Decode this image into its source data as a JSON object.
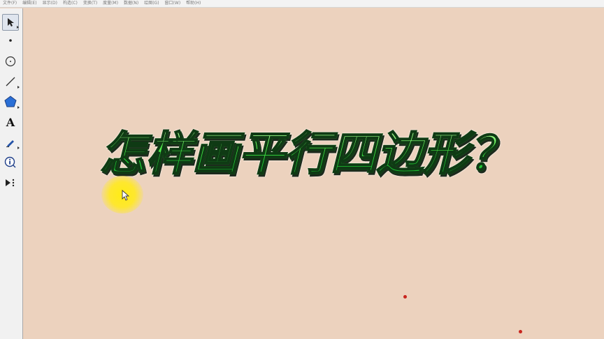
{
  "menu": {
    "items": [
      "文件(F)",
      "编辑(E)",
      "显示(D)",
      "构造(C)",
      "变换(T)",
      "度量(M)",
      "数据(N)",
      "绘图(G)",
      "窗口(W)",
      "帮助(H)"
    ]
  },
  "toolbar": {
    "tools": [
      {
        "name": "selection-arrow-tool",
        "icon": "arrow-pointer-icon",
        "active": true
      },
      {
        "name": "point-tool",
        "icon": "point-icon"
      },
      {
        "name": "compass-tool",
        "icon": "circle-icon"
      },
      {
        "name": "straightedge-tool",
        "icon": "line-segment-icon"
      },
      {
        "name": "polygon-tool",
        "icon": "pentagon-icon"
      },
      {
        "name": "text-tool",
        "icon": "letter-a-icon",
        "label": "A"
      },
      {
        "name": "marker-tool",
        "icon": "pen-icon"
      },
      {
        "name": "information-tool",
        "icon": "info-icon"
      },
      {
        "name": "custom-tool",
        "icon": "play-more-icon"
      }
    ]
  },
  "canvas": {
    "title": "怎样画平行四边形？",
    "background_color": "#ecd2be",
    "title_color": "#2bdc3c",
    "highlight_color": "#ffea18",
    "point_color": "#c8251e"
  }
}
